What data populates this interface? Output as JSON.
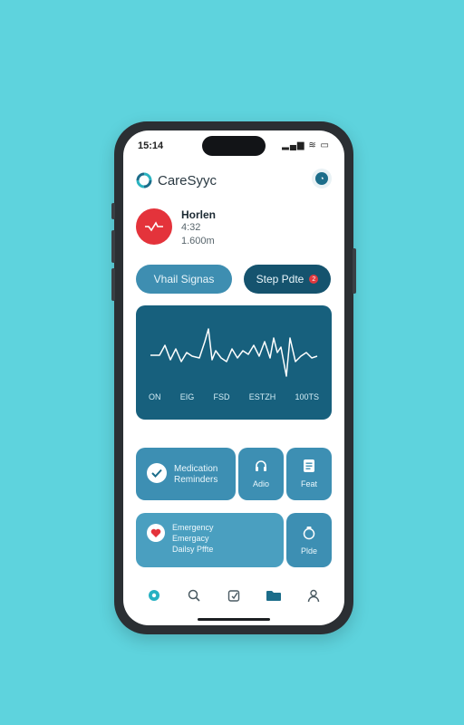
{
  "status_bar": {
    "time": "15:14",
    "icons": "▂▄▆ ≋ ▭"
  },
  "header": {
    "app_name": "CareSyyc"
  },
  "profile": {
    "name": "Horlen",
    "line2": "4:32",
    "line3": "1.600m"
  },
  "pills": {
    "vitals": "Vhail Signas",
    "steps": "Step Pdte",
    "steps_badge": "2"
  },
  "ecg": {
    "labels": [
      "ON",
      "EIG",
      "FSD",
      "ESTZH",
      "100TS"
    ]
  },
  "tiles": {
    "medication": {
      "line1": "Medication",
      "line2": "Reminders"
    },
    "audio": {
      "label": "Adio"
    },
    "feed": {
      "label": "Feat"
    },
    "emergency": {
      "line1": "Emergency",
      "line2": "Emergacy",
      "line3": "Dailsy Pffte"
    },
    "pills": {
      "label": "Plde"
    }
  },
  "nav": {
    "items": [
      "home-icon",
      "search-icon",
      "edit-icon",
      "folder-icon",
      "profile-icon"
    ]
  },
  "colors": {
    "background": "#5ed3dd",
    "accent": "#17607d",
    "tile": "#3d8fb3",
    "alert": "#e4333b"
  }
}
